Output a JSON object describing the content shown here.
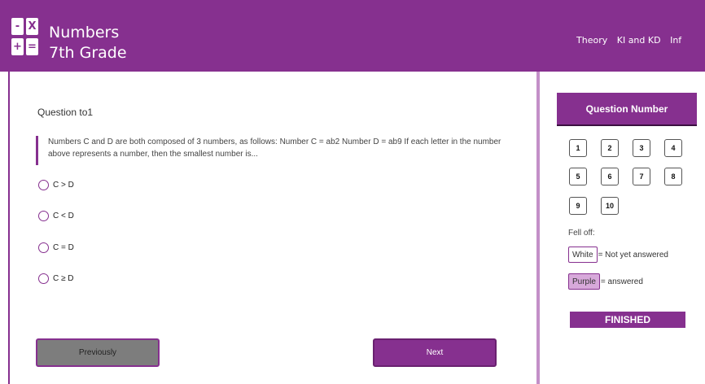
{
  "app": {
    "logo_tiles": [
      "-",
      "X",
      "+",
      "="
    ],
    "title_line1": "Numbers",
    "title_line2": "7th Grade"
  },
  "nav": {
    "items": [
      "Theory",
      "KI and KD",
      "Inf"
    ]
  },
  "question": {
    "title": "Question to1",
    "text": "Numbers C and D are both composed of 3 numbers, as follows: Number C = ab2 Number D = ab9 If each letter in the number above represents a number, then the smallest number is...",
    "options": [
      "C > D",
      "C < D",
      "C = D",
      "C ≥ D"
    ]
  },
  "buttons": {
    "previous": "Previously",
    "next": "Next"
  },
  "sidebar": {
    "header": "Question Number",
    "numbers": [
      "1",
      "2",
      "3",
      "4",
      "5",
      "6",
      "7",
      "8",
      "9",
      "10"
    ],
    "legend_title": "Fell off:",
    "legend": [
      {
        "chip": "White",
        "desc": "= Not yet answered"
      },
      {
        "chip": "Purple",
        "desc": "= answered"
      }
    ],
    "finished": "FINISHED"
  },
  "colors": {
    "accent": "#86308f",
    "answered_chip": "#d7a9da",
    "prev_button": "#7d7d7d"
  }
}
